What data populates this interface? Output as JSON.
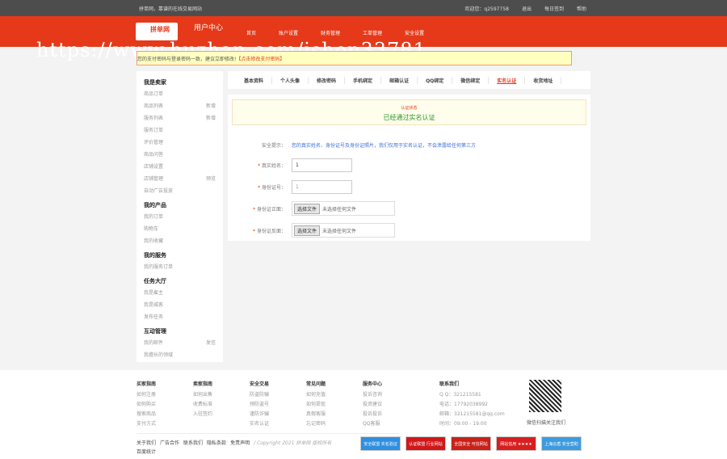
{
  "topbar": {
    "site": "拼单网，靠谱的在线交易网站",
    "welcome": "欢迎您：q2597758",
    "logout": "退出",
    "signin": "每日签到",
    "help": "帮助"
  },
  "header": {
    "logo": "拼单网",
    "title": "用户中心",
    "nav": [
      "首页",
      "账户设置",
      "财务管理",
      "工单管理",
      "安全设置"
    ]
  },
  "watermark": "https://www.huzhan.com/ishop33781",
  "notice": {
    "text": "您的支付密码与登录密码一致，建议立即修改!",
    "link": "【点击修改支付密码】"
  },
  "sidebar": [
    {
      "title": "我是卖家",
      "items": [
        {
          "label": "商品订单"
        },
        {
          "label": "商品列表",
          "extra": "新增"
        },
        {
          "label": "服务列表",
          "extra": "新增"
        },
        {
          "label": "服务订单"
        },
        {
          "label": "评价管理"
        },
        {
          "label": "商品问答"
        },
        {
          "label": "店铺设置"
        },
        {
          "label": "店铺管理",
          "extra": "预览"
        },
        {
          "label": "自动广告投放"
        }
      ]
    },
    {
      "title": "我的产品",
      "items": [
        {
          "label": "我的订单"
        },
        {
          "label": "购物车"
        },
        {
          "label": "我的收藏"
        }
      ]
    },
    {
      "title": "我的服务",
      "items": [
        {
          "label": "我的服务订单"
        }
      ]
    },
    {
      "title": "任务大厅",
      "items": [
        {
          "label": "我是雇主"
        },
        {
          "label": "我是威客"
        },
        {
          "label": "发布任务"
        }
      ]
    },
    {
      "title": "互动管理",
      "items": [
        {
          "label": "我的邮件",
          "extra": "发信"
        },
        {
          "label": "我擅长的领域"
        }
      ]
    }
  ],
  "tabs": [
    "基本资料",
    "个人头像",
    "修改密码",
    "手机绑定",
    "邮箱认证",
    "QQ绑定",
    "微信绑定",
    "实名认证",
    "收货地址"
  ],
  "active_tab": "实名认证",
  "status": {
    "label": "认证状态",
    "value": "已经通过实名认证"
  },
  "form": {
    "tip_label": "安全提示：",
    "tip": "您的真实姓名、身份证号及身份证照片，我们仅用于实名认证，不会泄露给任何第三方",
    "name_label": "真实姓名：",
    "name_value": "1",
    "id_label": "身份证号：",
    "id_value": "1",
    "front_label": "身份证正面：",
    "back_label": "身份证反面：",
    "choose": "选择文件",
    "nofile": "未选择任何文件",
    "star": "*"
  },
  "footer": {
    "cols": [
      {
        "title": "买家指南",
        "items": [
          "如何注册",
          "如何购买",
          "搜索商品",
          "支付方式"
        ]
      },
      {
        "title": "卖家指南",
        "items": [
          "如何出售",
          "收费标准",
          "入驻签约"
        ]
      },
      {
        "title": "安全交易",
        "items": [
          "防盗防骗",
          "预防盗号",
          "谨防诈骗",
          "实名认证"
        ]
      },
      {
        "title": "常见问题",
        "items": [
          "如何充值",
          "如何提现",
          "真假客服",
          "忘记密码"
        ]
      },
      {
        "title": "服务中心",
        "items": [
          "投诉咨询",
          "投资建议",
          "投诉投诉",
          "QQ客服"
        ]
      }
    ],
    "contact": {
      "title": "联系我们",
      "qq": "Q Q：321215581",
      "tel": "电话：17792038992",
      "mail": "邮箱：321215581@qq.com",
      "time": "时间：09:00 - 19:00"
    },
    "qr_caption": "微信扫描关注我们",
    "links": [
      "关于我们",
      "广告合作",
      "联系我们",
      "隐私条款",
      "免责声明"
    ],
    "copyright": "/ Copyright 2021 拼单网 版权所有",
    "stats": "百度统计",
    "badges": [
      {
        "label": "安全联盟 实名验证",
        "color": "#2f8fe0"
      },
      {
        "label": "认证联盟 行业网站",
        "color": "#d0181a"
      },
      {
        "label": "全国安全 可信网站",
        "color": "#c8211a"
      },
      {
        "label": "网站信用 ★★★★",
        "color": "#d81e1e"
      },
      {
        "label": "上海云盾 安全营助",
        "color": "#3d9be0"
      }
    ]
  }
}
